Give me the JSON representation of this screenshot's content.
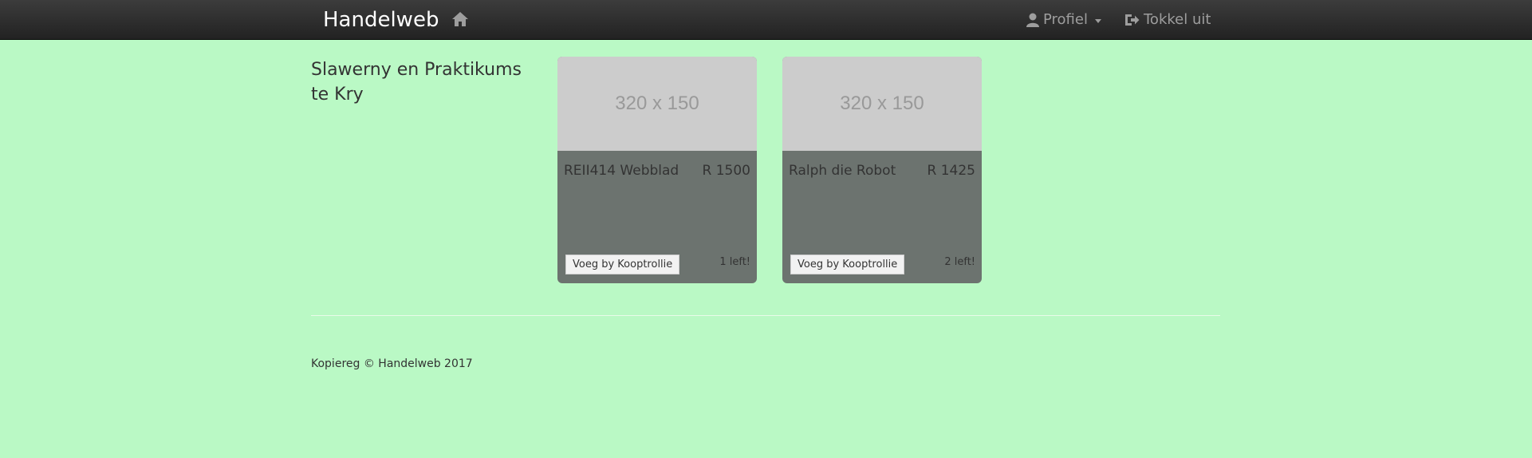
{
  "navbar": {
    "brand": "Handelweb",
    "home_icon": "home-icon",
    "profile_label": "Profiel",
    "profile_icon": "user-icon",
    "logout_label": "Tokkel uit",
    "logout_icon": "logout-icon"
  },
  "sidebar": {
    "title": "Slawerny en Praktikums te Kry"
  },
  "products": [
    {
      "image_text": "320 x 150",
      "title": "REII414 Webblad",
      "price": "R 1500",
      "button_label": "Voeg by Kooptrollie",
      "stock": "1 left!"
    },
    {
      "image_text": "320 x 150",
      "title": "Ralph die Robot",
      "price": "R 1425",
      "button_label": "Voeg by Kooptrollie",
      "stock": "2 left!"
    }
  ],
  "footer": {
    "copyright": "Kopiereg © Handelweb 2017"
  },
  "colors": {
    "background": "#baf9c5",
    "navbar": "#222222",
    "card": "#6c736f",
    "placeholder": "#cccccc"
  }
}
